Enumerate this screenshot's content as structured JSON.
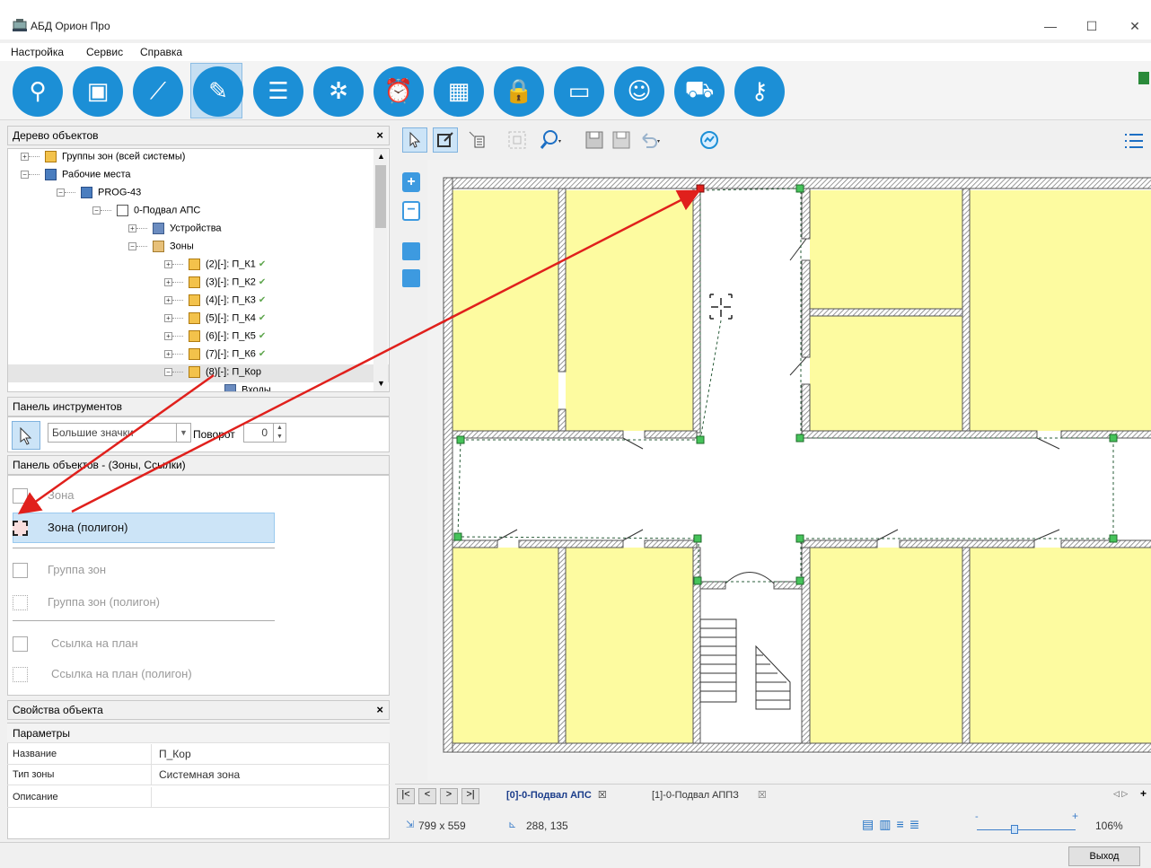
{
  "window": {
    "title": "АБД Орион Про",
    "controls": {
      "minimize": "—",
      "maximize": "☐",
      "close": "✕"
    }
  },
  "menu": [
    "Настройка",
    "Сервис",
    "Справка"
  ],
  "toolbar_icons": [
    "search-icon",
    "devices-icon",
    "barrier-icon",
    "plan-edit-icon",
    "list-icon",
    "wheel-icon",
    "alarm-clock-icon",
    "schedule-icon",
    "access-lock-icon",
    "id-card-icon",
    "users-icon",
    "car-icon",
    "key-icon"
  ],
  "object_tree": {
    "title": "Дерево объектов",
    "close": "×",
    "items": [
      {
        "label": "Группы зон (всей системы)",
        "icon": "zone",
        "level": 0,
        "exp": "+"
      },
      {
        "label": "Рабочие места",
        "icon": "pc",
        "level": 0,
        "exp": "−"
      },
      {
        "label": "PROG-43",
        "icon": "pc",
        "level": 1,
        "exp": "−"
      },
      {
        "label": "0-Подвал АПС",
        "icon": "plan",
        "level": 2,
        "exp": "−"
      },
      {
        "label": "Устройства",
        "icon": "dev",
        "level": 3,
        "exp": "+"
      },
      {
        "label": "Зоны",
        "icon": "folder",
        "level": 3,
        "exp": "−"
      },
      {
        "label": "(2)[-]: П_К1",
        "icon": "zone",
        "level": 4,
        "exp": "+",
        "check": true
      },
      {
        "label": "(3)[-]: П_К2",
        "icon": "zone",
        "level": 4,
        "exp": "+",
        "check": true
      },
      {
        "label": "(4)[-]: П_К3",
        "icon": "zone",
        "level": 4,
        "exp": "+",
        "check": true
      },
      {
        "label": "(5)[-]: П_К4",
        "icon": "zone",
        "level": 4,
        "exp": "+",
        "check": true
      },
      {
        "label": "(6)[-]: П_К5",
        "icon": "zone",
        "level": 4,
        "exp": "+",
        "check": true
      },
      {
        "label": "(7)[-]: П_К6",
        "icon": "zone",
        "level": 4,
        "exp": "+",
        "check": true
      },
      {
        "label": "(8)[-]: П_Кор",
        "icon": "zone",
        "level": 4,
        "exp": "−",
        "check": false,
        "selected": true
      },
      {
        "label": "Входы",
        "icon": "dev",
        "level": 5,
        "exp": "",
        "check": false
      }
    ]
  },
  "tool_panel": {
    "title": "Панель инструментов",
    "icon_size": "Большие значки",
    "rotate_label": "Поворот",
    "rotate_value": "0"
  },
  "object_panel": {
    "title": "Панель объектов - (Зоны, Ссылки)",
    "items": [
      {
        "label": "Зона",
        "enabled": false
      },
      {
        "label": "Зона (полигон)",
        "enabled": true,
        "selected": true
      },
      {
        "label": "Группа зон",
        "enabled": false
      },
      {
        "label": "Группа зон (полигон)",
        "enabled": false
      },
      {
        "label": "Ссылка на план",
        "enabled": false
      },
      {
        "label": "Ссылка на план (полигон)",
        "enabled": false
      }
    ]
  },
  "properties": {
    "title": "Свойства объекта",
    "close": "×",
    "section": "Параметры",
    "rows": [
      {
        "key": "Название",
        "value": "П_Кор"
      },
      {
        "key": "Тип зоны",
        "value": "Системная зона"
      },
      {
        "key": "Описание",
        "value": ""
      }
    ]
  },
  "plan_tabs": {
    "nav": [
      "|<",
      "<",
      ">",
      ">|"
    ],
    "tabs": [
      {
        "label": "[0]-0-Подвал АПС",
        "active": true,
        "close": "☒"
      },
      {
        "label": "[1]-0-Подвал АППЗ",
        "active": false,
        "close": "☒"
      }
    ]
  },
  "status": {
    "size": "799 x 559",
    "coords": "288, 135",
    "zoom": "106%"
  },
  "exit_button": "Выход",
  "colors": {
    "accent": "#1c8fd6",
    "zone_fill": "#fdfba0",
    "arrow": "#e0201c",
    "point": "#46c35a"
  }
}
